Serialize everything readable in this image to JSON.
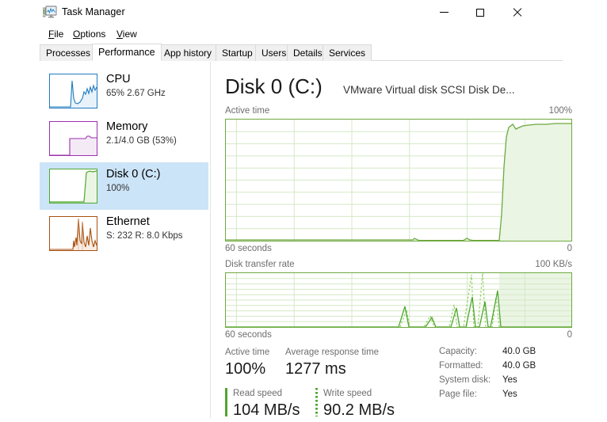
{
  "window": {
    "title": "Task Manager",
    "icon": "task-manager-icon",
    "controls": {
      "minimize": "—",
      "maximize": "□",
      "close": "✕"
    }
  },
  "menu": {
    "items": [
      {
        "label": "File",
        "accel": "F"
      },
      {
        "label": "Options",
        "accel": "O"
      },
      {
        "label": "View",
        "accel": "V"
      }
    ]
  },
  "tabs": [
    {
      "label": "Processes",
      "active": false
    },
    {
      "label": "Performance",
      "active": true
    },
    {
      "label": "App history",
      "active": false
    },
    {
      "label": "Startup",
      "active": false
    },
    {
      "label": "Users",
      "active": false
    },
    {
      "label": "Details",
      "active": false
    },
    {
      "label": "Services",
      "active": false
    }
  ],
  "sidebar": {
    "items": [
      {
        "name": "CPU",
        "sub": "65%  2.67 GHz",
        "color": "#1f7bbf",
        "selected": false
      },
      {
        "name": "Memory",
        "sub": "2.1/4.0 GB (53%)",
        "color": "#9b2fae",
        "selected": false
      },
      {
        "name": "Disk 0 (C:)",
        "sub": "100%",
        "color": "#4ea72e",
        "selected": true
      },
      {
        "name": "Ethernet",
        "sub": "S: 232 R: 8.0 Kbps",
        "color": "#a8500f",
        "selected": false
      }
    ]
  },
  "main": {
    "title": "Disk 0 (C:)",
    "subtitle": "VMware Virtual disk SCSI Disk De...",
    "charts": [
      {
        "label": "Active time",
        "max_label": "100%",
        "x_left_label": "60 seconds",
        "x_right_label": "0"
      },
      {
        "label": "Disk transfer rate",
        "max_label": "100 KB/s",
        "x_left_label": "60 seconds",
        "x_right_label": "0"
      }
    ],
    "stats": [
      {
        "label": "Active time",
        "value": "100%"
      },
      {
        "label": "Average response time",
        "value": "1277 ms"
      },
      {
        "label": "Read speed",
        "value": "104 MB/s",
        "bar": "solid"
      },
      {
        "label": "Write speed",
        "value": "90.2 MB/s",
        "bar": "dotted"
      }
    ],
    "info": [
      {
        "label": "Capacity:",
        "value": "40.0 GB"
      },
      {
        "label": "Formatted:",
        "value": "40.0 GB"
      },
      {
        "label": "System disk:",
        "value": "Yes"
      },
      {
        "label": "Page file:",
        "value": "Yes"
      }
    ]
  },
  "chart_data": [
    {
      "type": "area",
      "title": "Active time",
      "ylabel": "%",
      "ylim": [
        0,
        100
      ],
      "xlabel": "seconds ago",
      "xlim": [
        60,
        0
      ],
      "grid": true,
      "color": "#4ea72e",
      "x": [
        60,
        57,
        54,
        51,
        48,
        45,
        42,
        39,
        36,
        33,
        30,
        27,
        24,
        21,
        18,
        16,
        15,
        14,
        13,
        12,
        11,
        10,
        9,
        8,
        7,
        6,
        5,
        4,
        3,
        2,
        1,
        0
      ],
      "values": [
        0,
        0,
        0,
        0,
        0,
        0,
        0,
        0,
        2,
        1,
        0,
        0,
        0,
        0,
        1,
        2,
        1,
        0,
        0,
        0,
        3,
        45,
        88,
        96,
        93,
        90,
        92,
        95,
        96,
        97,
        97,
        97
      ]
    },
    {
      "type": "area",
      "title": "Disk transfer rate",
      "ylabel": "KB/s",
      "ylim": [
        0,
        100
      ],
      "xlabel": "seconds ago",
      "xlim": [
        60,
        0
      ],
      "grid": true,
      "color": "#4ea72e",
      "series": [
        {
          "name": "read",
          "x": [
            60,
            50,
            40,
            33,
            31,
            30,
            29,
            27,
            25,
            23,
            21,
            20,
            19,
            18,
            17,
            16,
            15,
            14,
            13,
            12,
            11,
            10,
            8,
            6,
            4,
            2,
            0
          ],
          "values": [
            0,
            0,
            0,
            0,
            12,
            36,
            8,
            0,
            6,
            18,
            2,
            0,
            10,
            30,
            6,
            0,
            4,
            14,
            0,
            38,
            55,
            5,
            62,
            0,
            0,
            0,
            0
          ]
        },
        {
          "name": "write",
          "x": [
            60,
            50,
            40,
            33,
            31,
            30,
            29,
            27,
            25,
            23,
            21,
            20,
            19,
            18,
            17,
            16,
            15,
            14,
            13,
            12,
            11,
            10,
            8,
            6,
            4,
            2,
            0
          ],
          "values": [
            0,
            0,
            0,
            0,
            10,
            30,
            4,
            0,
            4,
            12,
            0,
            0,
            18,
            52,
            4,
            0,
            30,
            88,
            10,
            70,
            95,
            2,
            0,
            0,
            0,
            0,
            0
          ]
        }
      ]
    }
  ]
}
